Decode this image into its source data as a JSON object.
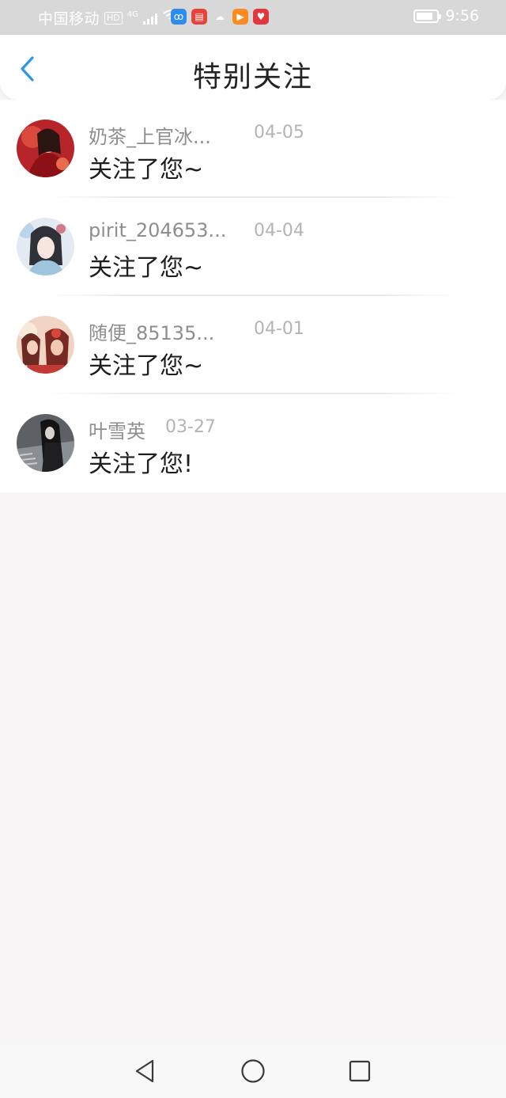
{
  "status_bar": {
    "carrier": "中国移动",
    "hd": "HD",
    "network": "4G",
    "time": "9:56",
    "battery_level": 0.85,
    "app_icons": [
      {
        "name": "wifi-app-icon",
        "color": "#2d8cf0",
        "glyph": "ꝏ"
      },
      {
        "name": "book-app-icon",
        "color": "#e8433a",
        "glyph": "▤"
      },
      {
        "name": "wechat-app-icon",
        "color": "#ffffff",
        "glyph": "☁"
      },
      {
        "name": "video-app-icon",
        "color": "#ff8a1f",
        "glyph": "▶"
      },
      {
        "name": "heart-app-icon",
        "color": "#e0383e",
        "glyph": "♥"
      }
    ]
  },
  "header": {
    "title": "特别关注",
    "back_icon": "chevron-left-icon",
    "accent": "#2a98e8"
  },
  "list": {
    "items": [
      {
        "name": "奶茶_上官冰...",
        "date": "04-05",
        "message": "关注了您~"
      },
      {
        "name": "pirit_204653...",
        "date": "04-04",
        "message": "关注了您~"
      },
      {
        "name": "随便_85135...",
        "date": "04-01",
        "message": "关注了您~"
      },
      {
        "name": "叶雪英",
        "date": "03-27",
        "message": "关注了您!"
      }
    ]
  },
  "nav_bar": {
    "back": "triangle-back-icon",
    "home": "circle-home-icon",
    "recents": "square-recents-icon"
  }
}
